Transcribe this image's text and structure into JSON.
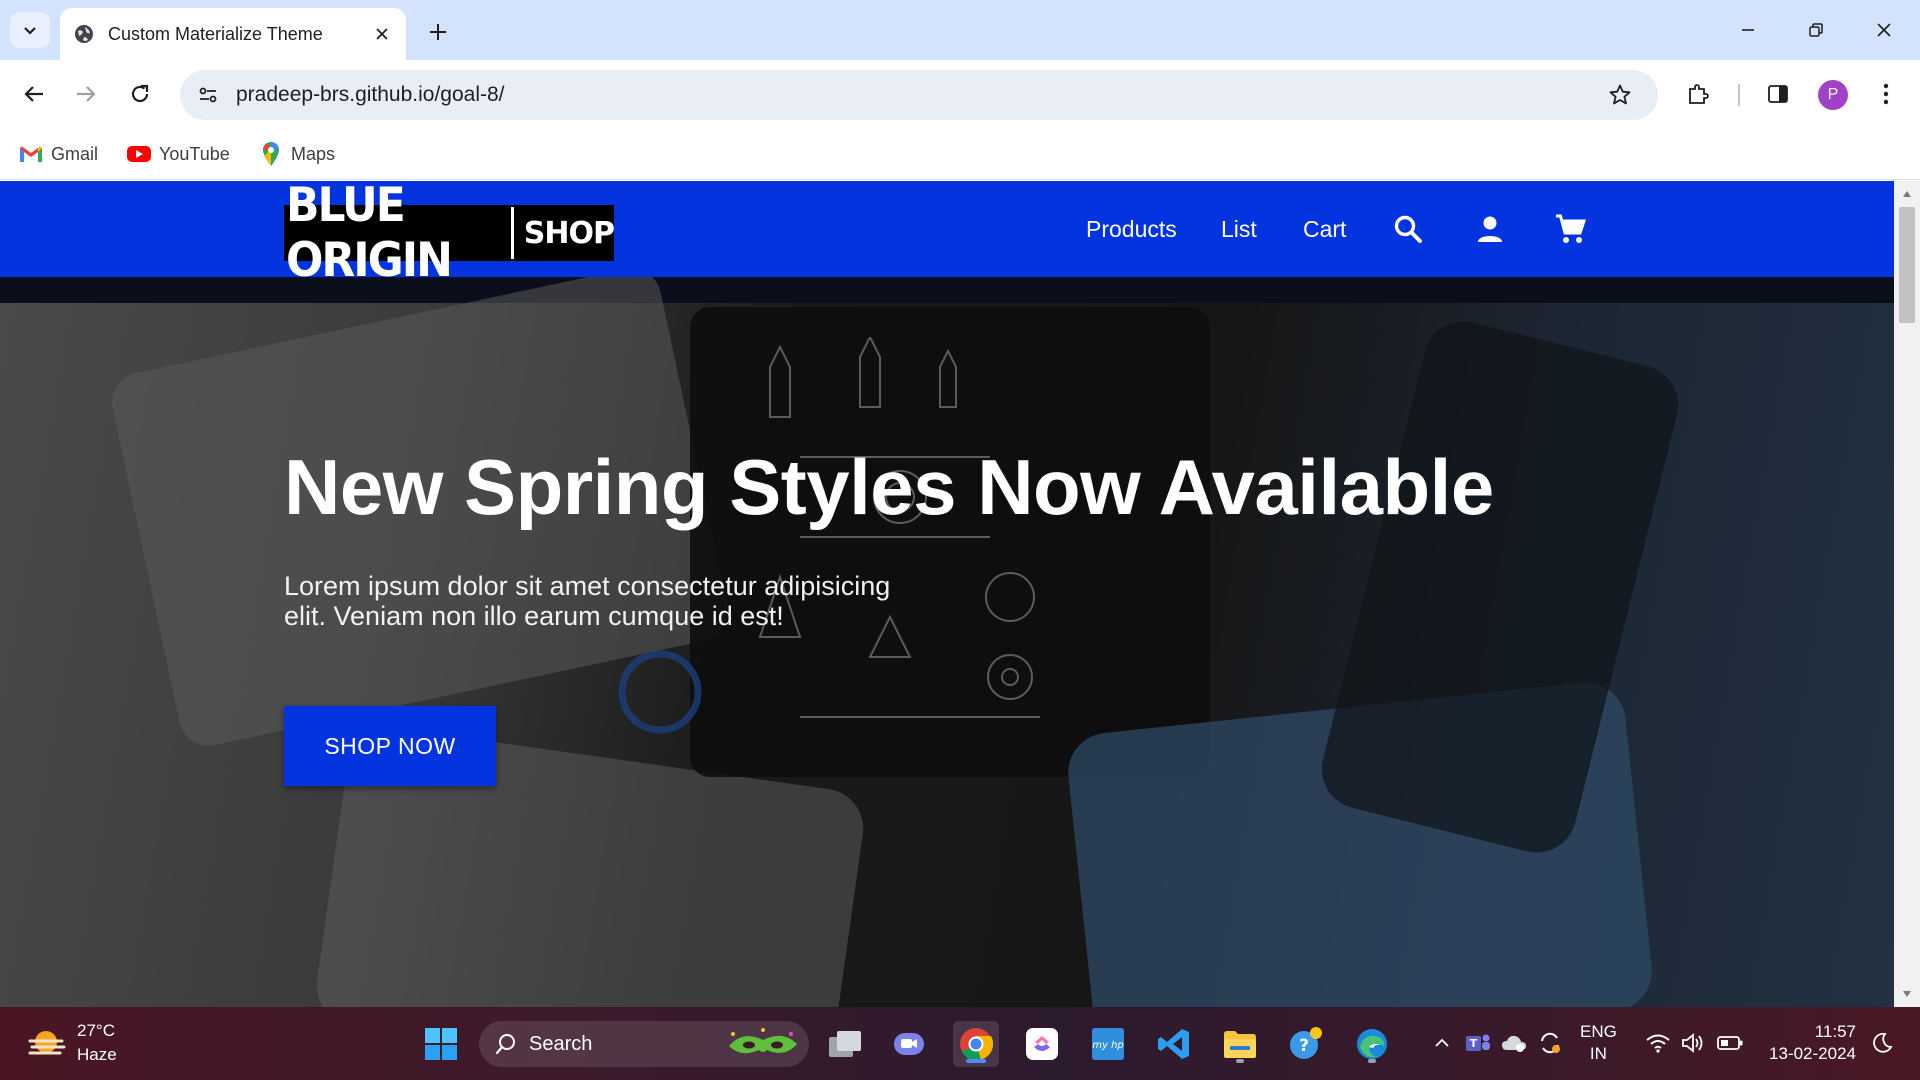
{
  "browser": {
    "tab_title": "Custom Materialize Theme",
    "url": "pradeep-brs.github.io/goal-8/",
    "profile_initial": "P",
    "bookmarks": [
      {
        "label": "Gmail",
        "icon": "gmail-icon"
      },
      {
        "label": "YouTube",
        "icon": "youtube-icon"
      },
      {
        "label": "Maps",
        "icon": "maps-icon"
      }
    ]
  },
  "site": {
    "logo_main": "BLUE ORIGIN",
    "logo_shop": "SHOP",
    "nav": [
      "Products",
      "List",
      "Cart"
    ],
    "nav_icons": [
      "search-icon",
      "account-icon",
      "cart-icon"
    ],
    "brand_color": "#0434e0"
  },
  "hero": {
    "title": "New Spring Styles Now Available",
    "text": "Lorem ipsum dolor sit amet consectetur adipisicing elit. Veniam non illo earum cumque id est!",
    "button": "SHOP NOW"
  },
  "taskbar": {
    "weather_temp": "27°C",
    "weather_desc": "Haze",
    "search_label": "Search",
    "lang_top": "ENG",
    "lang_bottom": "IN",
    "time": "11:57",
    "date": "13-02-2024"
  }
}
